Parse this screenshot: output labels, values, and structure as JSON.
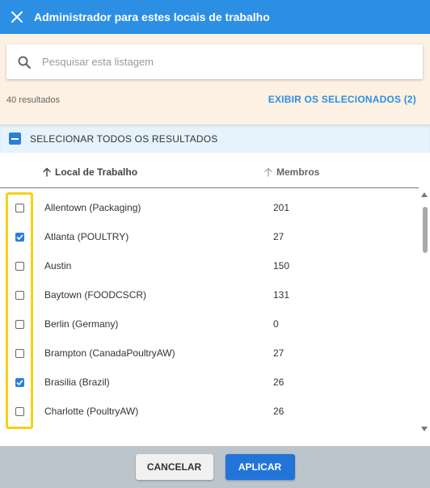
{
  "header": {
    "title": "Administrador para estes locais de trabalho",
    "close_icon": "close-icon"
  },
  "search": {
    "placeholder": "Pesquisar esta listagem",
    "value": "",
    "icon": "search-icon"
  },
  "results": {
    "count_label": "40 resultados",
    "show_selected_label": "EXIBIR OS SELECIONADOS (2)"
  },
  "select_all": {
    "label": "SELECIONAR TODOS OS RESULTADOS",
    "state": "indeterminate"
  },
  "columns": {
    "local": "Local de Trabalho",
    "members": "Membros"
  },
  "rows": [
    {
      "name": "Allentown (Packaging)",
      "members": "201",
      "checked": false
    },
    {
      "name": "Atlanta (POULTRY)",
      "members": "27",
      "checked": true
    },
    {
      "name": "Austin",
      "members": "150",
      "checked": false
    },
    {
      "name": "Baytown (FOODCSCR)",
      "members": "131",
      "checked": false
    },
    {
      "name": "Berlin (Germany)",
      "members": "0",
      "checked": false
    },
    {
      "name": "Brampton (CanadaPoultryAW)",
      "members": "27",
      "checked": false
    },
    {
      "name": "Brasilia (Brazil)",
      "members": "26",
      "checked": true
    },
    {
      "name": "Charlotte (PoultryAW)",
      "members": "26",
      "checked": false
    }
  ],
  "footer": {
    "cancel_label": "CANCELAR",
    "apply_label": "APLICAR"
  },
  "colors": {
    "header_bg": "#2d8fe4",
    "accent": "#2d7fd5",
    "search_zone_bg": "#fdf1e3",
    "highlight": "#f7d117",
    "footer_bg": "#bcc5cc"
  }
}
